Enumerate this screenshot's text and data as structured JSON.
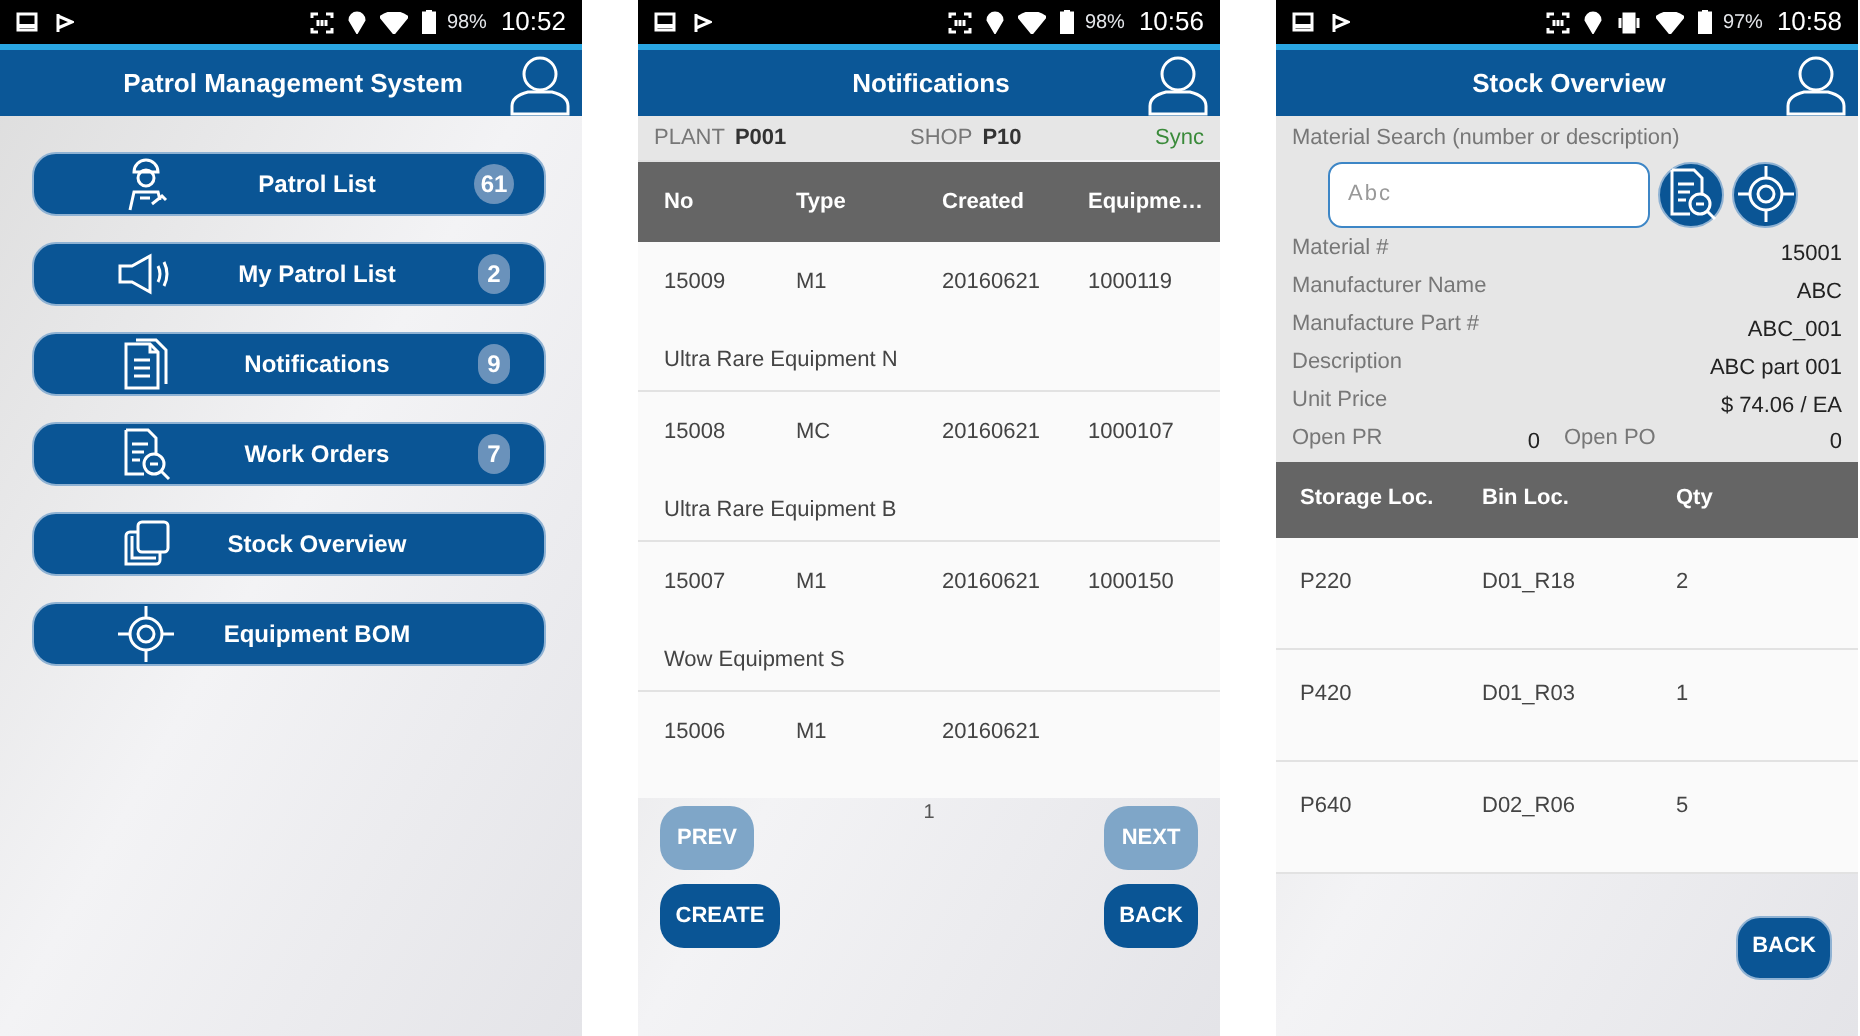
{
  "screens": [
    {
      "kind": "menu",
      "status_bar": {
        "vibrate_icon": false,
        "battery": "98%",
        "time": "10:52"
      },
      "title": "Patrol Management System",
      "menu_items": [
        {
          "label": "Patrol List",
          "count": "61"
        },
        {
          "label": "My Patrol List",
          "count": "2"
        },
        {
          "label": "Notifications",
          "count": "9"
        },
        {
          "label": "Work Orders",
          "count": "7"
        },
        {
          "label": "Stock Overview"
        },
        {
          "label": "Equipment BOM"
        }
      ]
    },
    {
      "kind": "notifications",
      "status_bar": {
        "vibrate_icon": false,
        "battery": "98%",
        "time": "10:56"
      },
      "title": "Notifications",
      "filters": [
        {
          "label": "PLANT",
          "value": "P001"
        },
        {
          "label": "SHOP",
          "value": "P10"
        }
      ],
      "sync": "Sync",
      "table": {
        "columns": [
          "No",
          "Type",
          "Created",
          "Equipme…"
        ],
        "rows": [
          {
            "cells": [
              "15009",
              "M1",
              "20160621",
              "1000119"
            ],
            "description": "Ultra Rare Equipment N"
          },
          {
            "cells": [
              "15008",
              "MC",
              "20160621",
              "1000107"
            ],
            "description": "Ultra Rare Equipment B"
          },
          {
            "cells": [
              "15007",
              "M1",
              "20160621",
              "1000150"
            ],
            "description": "Wow Equipment S"
          },
          {
            "cells": [
              "15006",
              "M1",
              "20160621"
            ]
          }
        ]
      },
      "page": "1",
      "buttons": [
        {
          "label": "PREV",
          "disabled": true
        },
        {
          "label": "NEXT",
          "disabled": true
        },
        {
          "label": "CREATE",
          "disabled": false
        },
        {
          "label": "BACK",
          "disabled": false
        }
      ]
    },
    {
      "kind": "stock",
      "status_bar": {
        "vibrate_icon": true,
        "battery": "97%",
        "time": "10:58"
      },
      "title": "Stock Overview",
      "search": {
        "label": "Material Search (number or description)",
        "placeholder": "Abc"
      },
      "fields": [
        {
          "label": "Material #",
          "value": "15001"
        },
        {
          "label": "Manufacturer Name",
          "value": "ABC"
        },
        {
          "label": "Manufacture Part #",
          "value": "ABC_001"
        },
        {
          "label": "Description",
          "value": "ABC part 001"
        },
        {
          "label": "Unit Price",
          "value": "$ 74.06 / EA"
        }
      ],
      "open_orders": [
        {
          "label": "Open PR",
          "value": "0"
        },
        {
          "label": "Open PO",
          "value": "0"
        }
      ],
      "table": {
        "columns": [
          "Storage Loc.",
          "Bin Loc.",
          "Qty"
        ],
        "rows": [
          [
            "P220",
            "D01_R18",
            "2"
          ],
          [
            "P420",
            "D01_R03",
            "1"
          ],
          [
            "P640",
            "D02_R06",
            "5"
          ]
        ]
      },
      "buttons": [
        {
          "label": "BACK"
        }
      ]
    }
  ]
}
